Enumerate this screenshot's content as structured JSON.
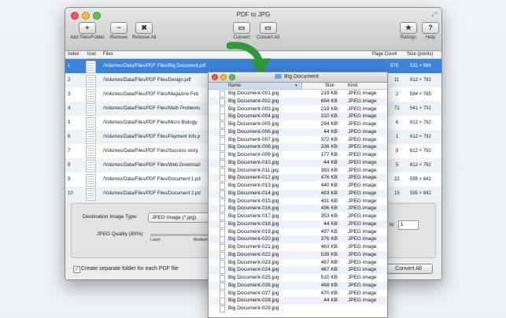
{
  "window": {
    "title": "PDF to JPG"
  },
  "toolbar": {
    "add": {
      "icon": "+",
      "label": "Add Files/Folder"
    },
    "remove": {
      "icon": "−",
      "label": "Remove"
    },
    "remove_all": {
      "icon": "✖",
      "label": "Remove All"
    },
    "convert": {
      "icon": "▭",
      "label": "Convert"
    },
    "convert_all": {
      "icon": "▭",
      "label": "Convert All"
    },
    "ratings": {
      "icon": "★",
      "label": "Ratings"
    },
    "help": {
      "icon": "?",
      "label": "Help"
    }
  },
  "table": {
    "headers": {
      "index": "Index",
      "icon": "Icon",
      "files": "Files",
      "page_count": "Page Count",
      "size": "Size (points)"
    },
    "rows": [
      {
        "index": "1",
        "file": "/Volumes/Data/Files/PDF Files/Big Document.pdf",
        "pages": "978",
        "size": "531 × 666",
        "selected": true
      },
      {
        "index": "2",
        "file": "/Volumes/Data/Files/PDF Files/Design.pdf",
        "pages": "11",
        "size": "612 × 792"
      },
      {
        "index": "3",
        "file": "/Volumes/Data/Files/PDF Files/Magazine Feb",
        "pages": "2",
        "size": "594 × 765"
      },
      {
        "index": "4",
        "file": "/Volumes/Data/Files/PDF Files/Math Problems",
        "pages": "71",
        "size": "541 × 731"
      },
      {
        "index": "5",
        "file": "/Volumes/Data/Files/PDF Files/Micro Biology.",
        "pages": "6",
        "size": "612 × 792"
      },
      {
        "index": "6",
        "file": "/Volumes/Data/Files/PDF Files/Payment Info.p",
        "pages": "1",
        "size": "612 × 792"
      },
      {
        "index": "7",
        "file": "/Volumes/Data/Files/PDF Files/Success story.",
        "pages": "8",
        "size": "612 × 792"
      },
      {
        "index": "8",
        "file": "/Volumes/Data/Files/PDF Files/Web Download",
        "pages": "5",
        "size": "612 × 792"
      },
      {
        "index": "9",
        "file": "/Volumes/Data/Files/PDF Files/Document 1.pd",
        "pages": "22",
        "size": "595 × 842"
      },
      {
        "index": "10",
        "file": "/Volumes/Data/Files/PDF Files/Document 2.pd",
        "pages": "15",
        "size": "595 × 842"
      }
    ]
  },
  "settings": {
    "dest_label": "Destination Image Type:",
    "dest_value": "JPEG Image (*.jpg)",
    "quality_label": "JPEG Quality (80%):",
    "scale_least": "Least",
    "scale_medium": "Medium",
    "range_to": "to",
    "range_end": "1"
  },
  "footer": {
    "separate_folder": "Create separate folder for each PDF file",
    "checkbox_mark": "✓",
    "convert_all": "Convert All"
  },
  "finder": {
    "title": "Big Document",
    "headers": {
      "name": "Name",
      "size": "Size",
      "kind": "Kind"
    },
    "files": [
      {
        "name": "Big Document-001.jpg",
        "size": "219 KB",
        "kind": "JPEG image"
      },
      {
        "name": "Big Document-002.jpg",
        "size": "684 KB",
        "kind": "JPEG image"
      },
      {
        "name": "Big Document-003.jpg",
        "size": "219 KB",
        "kind": "JPEG image"
      },
      {
        "name": "Big Document-004.jpg",
        "size": "310 KB",
        "kind": "JPEG image"
      },
      {
        "name": "Big Document-005.jpg",
        "size": "294 KB",
        "kind": "JPEG image"
      },
      {
        "name": "Big Document-006.jpg",
        "size": "44 KB",
        "kind": "JPEG image"
      },
      {
        "name": "Big Document-007.jpg",
        "size": "372 KB",
        "kind": "JPEG image"
      },
      {
        "name": "Big Document-008.jpg",
        "size": "336 KB",
        "kind": "JPEG image"
      },
      {
        "name": "Big Document-009.jpg",
        "size": "177 KB",
        "kind": "JPEG image"
      },
      {
        "name": "Big Document-010.jpg",
        "size": "44 KB",
        "kind": "JPEG image"
      },
      {
        "name": "Big Document-011.jpg",
        "size": "383 KB",
        "kind": "JPEG image"
      },
      {
        "name": "Big Document-012.jpg",
        "size": "476 KB",
        "kind": "JPEG image"
      },
      {
        "name": "Big Document-013.jpg",
        "size": "440 KB",
        "kind": "JPEG image"
      },
      {
        "name": "Big Document-014.jpg",
        "size": "483 KB",
        "kind": "JPEG image"
      },
      {
        "name": "Big Document-015.jpg",
        "size": "491 KB",
        "kind": "JPEG image"
      },
      {
        "name": "Big Document-016.jpg",
        "size": "496 KB",
        "kind": "JPEG image"
      },
      {
        "name": "Big Document-017.jpg",
        "size": "353 KB",
        "kind": "JPEG image"
      },
      {
        "name": "Big Document-018.jpg",
        "size": "44 KB",
        "kind": "JPEG image"
      },
      {
        "name": "Big Document-019.jpg",
        "size": "497 KB",
        "kind": "JPEG image"
      },
      {
        "name": "Big Document-020.jpg",
        "size": "376 KB",
        "kind": "JPEG image"
      },
      {
        "name": "Big Document-021.jpg",
        "size": "463 KB",
        "kind": "JPEG image"
      },
      {
        "name": "Big Document-022.jpg",
        "size": "539 KB",
        "kind": "JPEG image"
      },
      {
        "name": "Big Document-023.jpg",
        "size": "467 KB",
        "kind": "JPEG image"
      },
      {
        "name": "Big Document-024.jpg",
        "size": "467 KB",
        "kind": "JPEG image"
      },
      {
        "name": "Big Document-025.jpg",
        "size": "510 KB",
        "kind": "JPEG image"
      },
      {
        "name": "Big Document-026.jpg",
        "size": "468 KB",
        "kind": "JPEG image"
      },
      {
        "name": "Big Document-027.jpg",
        "size": "470 KB",
        "kind": "JPEG image"
      },
      {
        "name": "Big Document-028.jpg",
        "size": "44 KB",
        "kind": "JPEG image"
      },
      {
        "name": "Big Document-029.jpg",
        "size": "",
        "kind": ""
      }
    ]
  },
  "colors": {
    "selection": "#3b84d9",
    "arrow": "#2f9a3a",
    "folder": "#6aa9e8"
  }
}
